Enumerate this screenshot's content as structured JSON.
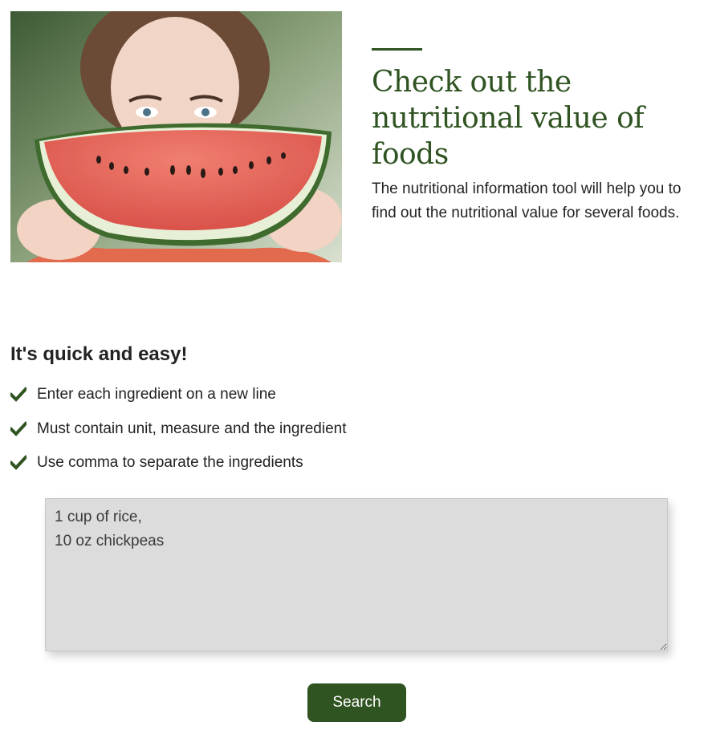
{
  "hero": {
    "title": "Check out the nutritional value of foods",
    "description": "The nutritional information tool will help you to find out the nutritional value for several foods."
  },
  "steps": {
    "title": "It's quick and easy!",
    "items": [
      "Enter each ingredient on a new line",
      "Must contain unit, measure and the ingredient",
      "Use comma to separate the ingredients"
    ]
  },
  "form": {
    "ingredients_value": "1 cup of rice,\n10 oz chickpeas",
    "search_label": "Search"
  },
  "colors": {
    "accent": "#2f5321",
    "textarea_bg": "#dcdcdc",
    "text": "#222222"
  },
  "icons": {
    "check": "check-icon"
  }
}
